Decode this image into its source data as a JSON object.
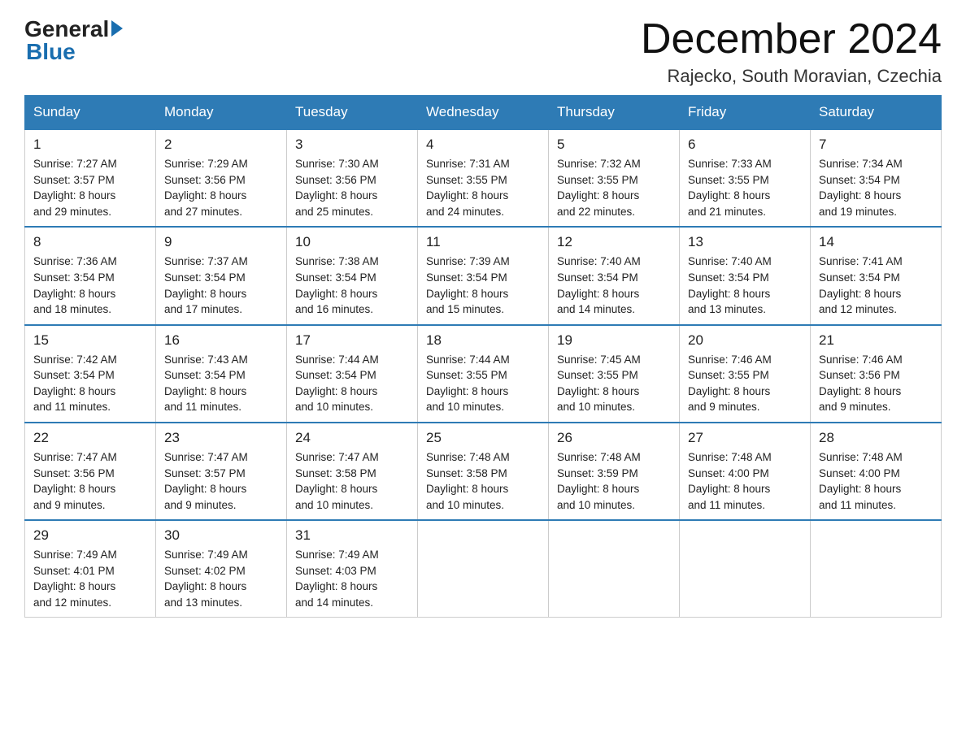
{
  "header": {
    "logo_text": "General",
    "logo_blue": "Blue",
    "month_title": "December 2024",
    "location": "Rajecko, South Moravian, Czechia"
  },
  "days_of_week": [
    "Sunday",
    "Monday",
    "Tuesday",
    "Wednesday",
    "Thursday",
    "Friday",
    "Saturday"
  ],
  "weeks": [
    [
      {
        "day": "1",
        "sunrise": "7:27 AM",
        "sunset": "3:57 PM",
        "daylight": "8 hours and 29 minutes."
      },
      {
        "day": "2",
        "sunrise": "7:29 AM",
        "sunset": "3:56 PM",
        "daylight": "8 hours and 27 minutes."
      },
      {
        "day": "3",
        "sunrise": "7:30 AM",
        "sunset": "3:56 PM",
        "daylight": "8 hours and 25 minutes."
      },
      {
        "day": "4",
        "sunrise": "7:31 AM",
        "sunset": "3:55 PM",
        "daylight": "8 hours and 24 minutes."
      },
      {
        "day": "5",
        "sunrise": "7:32 AM",
        "sunset": "3:55 PM",
        "daylight": "8 hours and 22 minutes."
      },
      {
        "day": "6",
        "sunrise": "7:33 AM",
        "sunset": "3:55 PM",
        "daylight": "8 hours and 21 minutes."
      },
      {
        "day": "7",
        "sunrise": "7:34 AM",
        "sunset": "3:54 PM",
        "daylight": "8 hours and 19 minutes."
      }
    ],
    [
      {
        "day": "8",
        "sunrise": "7:36 AM",
        "sunset": "3:54 PM",
        "daylight": "8 hours and 18 minutes."
      },
      {
        "day": "9",
        "sunrise": "7:37 AM",
        "sunset": "3:54 PM",
        "daylight": "8 hours and 17 minutes."
      },
      {
        "day": "10",
        "sunrise": "7:38 AM",
        "sunset": "3:54 PM",
        "daylight": "8 hours and 16 minutes."
      },
      {
        "day": "11",
        "sunrise": "7:39 AM",
        "sunset": "3:54 PM",
        "daylight": "8 hours and 15 minutes."
      },
      {
        "day": "12",
        "sunrise": "7:40 AM",
        "sunset": "3:54 PM",
        "daylight": "8 hours and 14 minutes."
      },
      {
        "day": "13",
        "sunrise": "7:40 AM",
        "sunset": "3:54 PM",
        "daylight": "8 hours and 13 minutes."
      },
      {
        "day": "14",
        "sunrise": "7:41 AM",
        "sunset": "3:54 PM",
        "daylight": "8 hours and 12 minutes."
      }
    ],
    [
      {
        "day": "15",
        "sunrise": "7:42 AM",
        "sunset": "3:54 PM",
        "daylight": "8 hours and 11 minutes."
      },
      {
        "day": "16",
        "sunrise": "7:43 AM",
        "sunset": "3:54 PM",
        "daylight": "8 hours and 11 minutes."
      },
      {
        "day": "17",
        "sunrise": "7:44 AM",
        "sunset": "3:54 PM",
        "daylight": "8 hours and 10 minutes."
      },
      {
        "day": "18",
        "sunrise": "7:44 AM",
        "sunset": "3:55 PM",
        "daylight": "8 hours and 10 minutes."
      },
      {
        "day": "19",
        "sunrise": "7:45 AM",
        "sunset": "3:55 PM",
        "daylight": "8 hours and 10 minutes."
      },
      {
        "day": "20",
        "sunrise": "7:46 AM",
        "sunset": "3:55 PM",
        "daylight": "8 hours and 9 minutes."
      },
      {
        "day": "21",
        "sunrise": "7:46 AM",
        "sunset": "3:56 PM",
        "daylight": "8 hours and 9 minutes."
      }
    ],
    [
      {
        "day": "22",
        "sunrise": "7:47 AM",
        "sunset": "3:56 PM",
        "daylight": "8 hours and 9 minutes."
      },
      {
        "day": "23",
        "sunrise": "7:47 AM",
        "sunset": "3:57 PM",
        "daylight": "8 hours and 9 minutes."
      },
      {
        "day": "24",
        "sunrise": "7:47 AM",
        "sunset": "3:58 PM",
        "daylight": "8 hours and 10 minutes."
      },
      {
        "day": "25",
        "sunrise": "7:48 AM",
        "sunset": "3:58 PM",
        "daylight": "8 hours and 10 minutes."
      },
      {
        "day": "26",
        "sunrise": "7:48 AM",
        "sunset": "3:59 PM",
        "daylight": "8 hours and 10 minutes."
      },
      {
        "day": "27",
        "sunrise": "7:48 AM",
        "sunset": "4:00 PM",
        "daylight": "8 hours and 11 minutes."
      },
      {
        "day": "28",
        "sunrise": "7:48 AM",
        "sunset": "4:00 PM",
        "daylight": "8 hours and 11 minutes."
      }
    ],
    [
      {
        "day": "29",
        "sunrise": "7:49 AM",
        "sunset": "4:01 PM",
        "daylight": "8 hours and 12 minutes."
      },
      {
        "day": "30",
        "sunrise": "7:49 AM",
        "sunset": "4:02 PM",
        "daylight": "8 hours and 13 minutes."
      },
      {
        "day": "31",
        "sunrise": "7:49 AM",
        "sunset": "4:03 PM",
        "daylight": "8 hours and 14 minutes."
      },
      null,
      null,
      null,
      null
    ]
  ],
  "labels": {
    "sunrise": "Sunrise:",
    "sunset": "Sunset:",
    "daylight": "Daylight:"
  }
}
